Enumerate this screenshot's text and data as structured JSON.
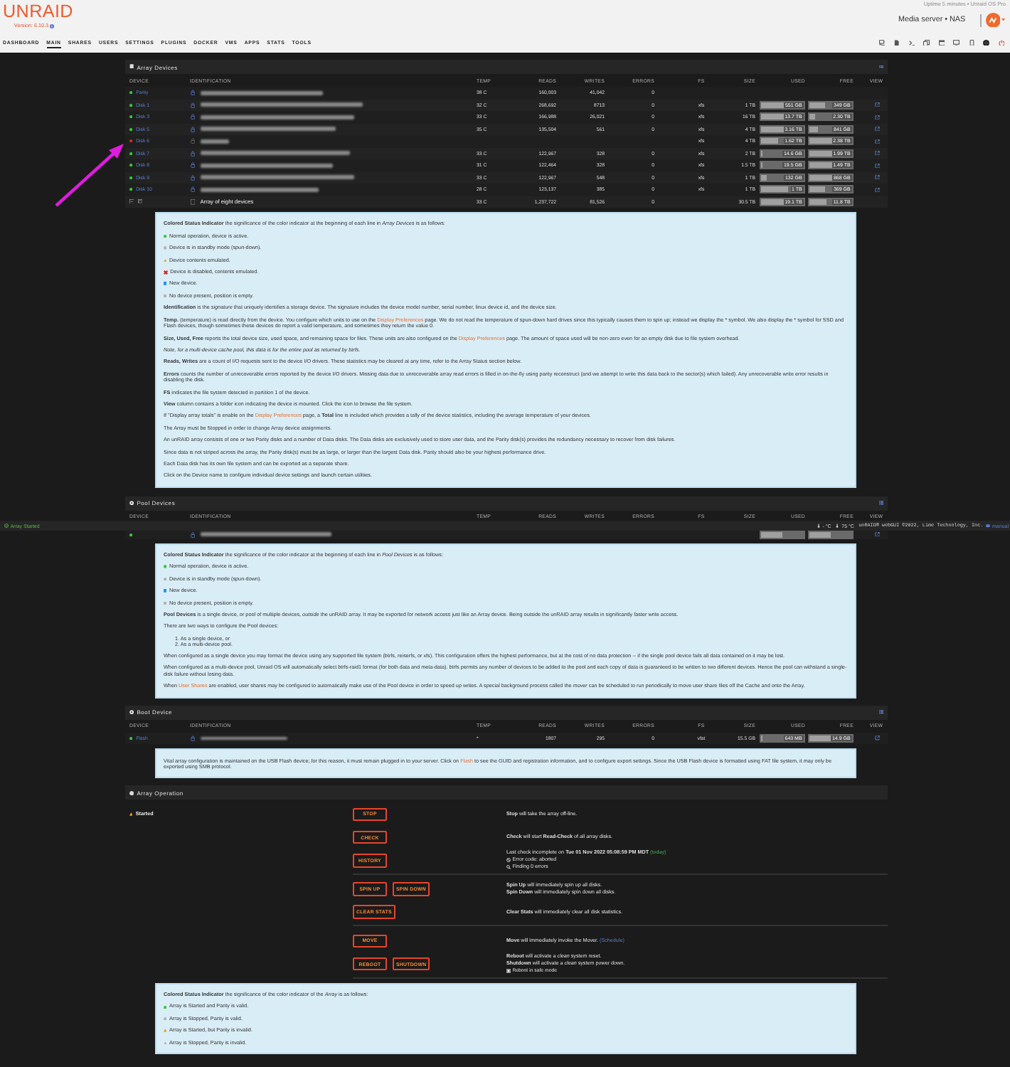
{
  "header": {
    "logo": "UNRAID",
    "version": "Version: 6.10.3",
    "uptime": "Uptime 5 minutes • Unraid OS Pro",
    "server": "Media server • NAS"
  },
  "nav": [
    {
      "label": "DASHBOARD",
      "selected": false
    },
    {
      "label": "MAIN",
      "selected": true
    },
    {
      "label": "SHARES",
      "selected": false
    },
    {
      "label": "USERS",
      "selected": false
    },
    {
      "label": "SETTINGS",
      "selected": false
    },
    {
      "label": "PLUGINS",
      "selected": false
    },
    {
      "label": "DOCKER",
      "selected": false
    },
    {
      "label": "VMS",
      "selected": false
    },
    {
      "label": "APPS",
      "selected": false
    },
    {
      "label": "STATS",
      "selected": false
    },
    {
      "label": "TOOLS",
      "selected": false
    }
  ],
  "toolbar": [
    {
      "kind": "chat"
    },
    {
      "kind": "doc"
    },
    {
      "kind": "terminal"
    },
    {
      "kind": "copy"
    },
    {
      "kind": "window"
    },
    {
      "kind": "monitor"
    },
    {
      "kind": "phone"
    },
    {
      "kind": "globe"
    },
    {
      "kind": "power"
    }
  ],
  "array_devices": {
    "title": "Array Devices",
    "columns": [
      "DEVICE",
      "IDENTIFICATION",
      "TEMP",
      "READS",
      "WRITES",
      "ERRORS",
      "FS",
      "SIZE",
      "USED",
      "FREE",
      "VIEW"
    ],
    "rows": [
      {
        "kind": "device",
        "color": "#33cc33",
        "name": "Parity",
        "mounted": true,
        "temp": "38 C",
        "reads": "160,003",
        "writes": "41,042",
        "errors": "0"
      },
      {
        "kind": "device",
        "color": "#33cc33",
        "name": "Disk 1",
        "mounted": true,
        "temp": "32 C",
        "reads": "268,692",
        "writes": "8713",
        "errors": "0",
        "fs": "xfs",
        "size": "1 TB",
        "used": {
          "text": "551 GB",
          "level": 0.55
        },
        "free": {
          "text": "349 GB",
          "level": 0.35
        },
        "view": true
      },
      {
        "kind": "device",
        "color": "#33cc33",
        "name": "Disk 3",
        "mounted": true,
        "temp": "33 C",
        "reads": "166,988",
        "writes": "26,021",
        "errors": "0",
        "fs": "xfs",
        "size": "16 TB",
        "used": {
          "text": "13.7 TB",
          "level": 0.86
        },
        "free": {
          "text": "2.30 TB",
          "level": 0.14
        },
        "view": true
      },
      {
        "kind": "device",
        "color": "#33cc33",
        "name": "Disk 5",
        "mounted": true,
        "temp": "35 C",
        "reads": "135,504",
        "writes": "561",
        "errors": "0",
        "fs": "xfs",
        "size": "4 TB",
        "used": {
          "text": "3.16 TB",
          "level": 0.79
        },
        "free": {
          "text": "841 GB",
          "level": 0.21
        },
        "view": true
      },
      {
        "kind": "device",
        "color": "#dd2222",
        "name": "Disk 6",
        "mounted": false,
        "fs": "xfs",
        "size": "4 TB",
        "used": {
          "text": "1.62 TB",
          "level": 0.41
        },
        "free": {
          "text": "2.38 TB",
          "level": 0.59
        },
        "view": true
      },
      {
        "kind": "device",
        "color": "#33cc33",
        "name": "Disk 7",
        "mounted": true,
        "temp": "33 C",
        "reads": "122,967",
        "writes": "328",
        "errors": "0",
        "fs": "xfs",
        "size": "2 TB",
        "used": {
          "text": "14.6 GB",
          "level": 0.01
        },
        "free": {
          "text": "1.99 TB",
          "level": 0.99
        },
        "view": true
      },
      {
        "kind": "device",
        "color": "#33cc33",
        "name": "Disk 8",
        "mounted": true,
        "temp": "31 C",
        "reads": "122,464",
        "writes": "328",
        "errors": "0",
        "fs": "xfs",
        "size": "1.5 TB",
        "used": {
          "text": "19.5 GB",
          "level": 0.01
        },
        "free": {
          "text": "1.49 TB",
          "level": 0.99
        },
        "view": true
      },
      {
        "kind": "device",
        "color": "#33cc33",
        "name": "Disk 9",
        "mounted": true,
        "temp": "33 C",
        "reads": "122,967",
        "writes": "548",
        "errors": "0",
        "fs": "xfs",
        "size": "1 TB",
        "used": {
          "text": "132 GB",
          "level": 0.13
        },
        "free": {
          "text": "868 GB",
          "level": 0.87
        },
        "view": true
      },
      {
        "kind": "device",
        "color": "#33cc33",
        "name": "Disk 10",
        "mounted": true,
        "temp": "28 C",
        "reads": "123,137",
        "writes": "385",
        "errors": "0",
        "fs": "xfs",
        "size": "1 TB",
        "used": {
          "text": "1 TB",
          "level": 0.63
        },
        "free": {
          "text": "369 GB",
          "level": 0.37
        },
        "view": true
      },
      {
        "kind": "total",
        "text": "Array of eight devices",
        "temp": "33 C",
        "reads": "1,237,722",
        "writes": "81,526",
        "errors": "0",
        "size": "30.5 TB",
        "used": {
          "text": "19.1 TB",
          "level": 0.63
        },
        "free": {
          "text": "11.8 TB",
          "level": 0.39
        }
      }
    ],
    "help": [
      {
        "kind": "text",
        "parts": [
          {
            "kind": "text",
            "text": "**Colored Status Indicator** the significance of the color indicator at the beginning of each line in *Array Devices* is as follows:"
          }
        ]
      },
      {
        "kind": "legend",
        "icon": {
          "kind": "circle",
          "color": "#33cc33"
        },
        "text": "Normal operation, device is active."
      },
      {
        "kind": "legend",
        "icon": {
          "kind": "circle",
          "color": "#b4b4b4"
        },
        "text": "Device is in standby mode (spun-down)."
      },
      {
        "kind": "legend",
        "icon": {
          "kind": "triangle",
          "color": "#f0a30a"
        },
        "text": "Device contents emulated."
      },
      {
        "kind": "legend",
        "icon": {
          "kind": "cross",
          "color": "#e22828"
        },
        "text": "Device is disabled, contents emulated."
      },
      {
        "kind": "legend",
        "icon": {
          "kind": "square",
          "color": "#1e90ff"
        },
        "text": "New device."
      },
      {
        "kind": "legend",
        "icon": {
          "kind": "square",
          "color": "#b4b4b4"
        },
        "text": "No device present, position is empty."
      },
      {
        "kind": "text",
        "parts": [
          {
            "kind": "text",
            "text": "**Identification** is the *signature* that uniquely identifies a storage device. The signature includes the device model number, serial number, linux device id, and the device size."
          }
        ]
      },
      {
        "kind": "text",
        "parts": [
          {
            "kind": "text",
            "text": "**Temp.** (temperature) is read directly from the device. You configure which units to use on the "
          },
          {
            "kind": "link",
            "text": "Display Preferences"
          },
          {
            "kind": "plain",
            "text": " page. We do not read the temperature of spun-down hard drives since this typically causes them to spin up; instead we display the * symbol. We also display the * symbol for SSD and Flash devices, though sometimes these devices do report a valid temperature, and sometimes they return the value 0."
          }
        ]
      },
      {
        "kind": "text",
        "parts": [
          {
            "kind": "text",
            "text": "**Size, Used, Free** reports the total device size, used space, and remaining space for files. These units are also configured on the "
          },
          {
            "kind": "link",
            "text": "Display Preferences"
          },
          {
            "kind": "text",
            "text": " page. The amount of space used will be non-zero even for an empty disk due to file system overhead."
          }
        ]
      },
      {
        "kind": "note",
        "parts": [
          {
            "kind": "text",
            "text": "Note, for a multi-device cache pool, this data is for the entire pool as returned by btrfs."
          }
        ]
      },
      {
        "kind": "text",
        "parts": [
          {
            "kind": "text",
            "text": "**Reads, Writes** are a count of I/O requests sent to the device I/O drivers. These statistics may be cleared at any time, refer to the Array Status section below."
          }
        ]
      },
      {
        "kind": "text",
        "parts": [
          {
            "kind": "text",
            "text": "**Errors** counts the number of unrecoverable errors reported by the device I/O drivers. Missing data due to unrecoverable array read errors is filled in on-the-fly using parity reconstruct (and we attempt to write this data back to the sector(s) which failed). Any unrecoverable write error results in disabling the disk."
          }
        ]
      },
      {
        "kind": "text",
        "parts": [
          {
            "kind": "text",
            "text": "**FS** indicates the file system detected in partition 1 of the device."
          }
        ]
      },
      {
        "kind": "text",
        "parts": [
          {
            "kind": "text",
            "text": "**View** column contains a folder icon indicating the device is mounted. Click the icon to browse the file system."
          }
        ]
      },
      {
        "kind": "text",
        "parts": [
          {
            "kind": "text",
            "text": "If \"Display array totals\" is enable on the "
          },
          {
            "kind": "link",
            "text": "Display Preferences"
          },
          {
            "kind": "text",
            "text": " page, a **Total** line is included which provides a tally of the device statistics, including the average temperature of your devices."
          }
        ]
      },
      {
        "kind": "text",
        "parts": [
          {
            "kind": "text",
            "text": "The Array must be Stopped in order to change Array device assignments."
          }
        ]
      },
      {
        "kind": "text",
        "parts": [
          {
            "kind": "text",
            "text": "An unRAID array consists of one or two Parity disks and a number of Data disks. The Data disks are exclusively used to store user data, and the Parity disk(s) provides the redundancy necessary to recover from disk failures."
          }
        ]
      },
      {
        "kind": "text",
        "parts": [
          {
            "kind": "text",
            "text": "Since data is not striped across the array, the Parity disk(s) must be as large, or larger than the largest Data disk. Parity should also be your highest performance drive."
          }
        ]
      },
      {
        "kind": "text",
        "parts": [
          {
            "kind": "text",
            "text": "Each Data disk has its own file system and can be exported as a separate share."
          }
        ]
      },
      {
        "kind": "text",
        "parts": [
          {
            "kind": "text",
            "text": "Click on the Device name to configure individual device settings and launch certain utilities."
          }
        ]
      }
    ]
  },
  "pool_devices": {
    "title": "Pool Devices",
    "columns": [
      "DEVICE",
      "IDENTIFICATION",
      "TEMP",
      "READS",
      "WRITES",
      "ERRORS",
      "FS",
      "SIZE",
      "USED",
      "FREE",
      "VIEW"
    ],
    "rows": [
      {
        "kind": "device",
        "color": "#33cc33",
        "mounted": true,
        "used": {
          "level": 0.5
        },
        "free": {
          "level": 0.5
        },
        "view": true
      }
    ],
    "help": [
      {
        "kind": "text",
        "parts": [
          {
            "kind": "text",
            "text": "**Colored Status Indicator** the significance of the color indicator at the beginning of each line in *Pool Devices* is as follows:"
          }
        ]
      },
      {
        "kind": "legend",
        "icon": {
          "kind": "circle",
          "color": "#33cc33"
        },
        "text": "Normal operation, device is active."
      },
      {
        "kind": "legend",
        "icon": {
          "kind": "circle",
          "color": "#b4b4b4"
        },
        "text": "Device is in standby mode (spun-down)."
      },
      {
        "kind": "legend",
        "icon": {
          "kind": "square",
          "color": "#1e90ff"
        },
        "text": "New device."
      },
      {
        "kind": "legend",
        "icon": {
          "kind": "square",
          "color": "#b4b4b4"
        },
        "text": "No device present, position is empty."
      },
      {
        "kind": "text",
        "parts": [
          {
            "kind": "text",
            "text": "**Pool Devices** is a single device, or pool of multiple devices, *outside* the unRAID array. It may be exported for network access just like an Array device. Being outside the unRAID array results in significantly faster write access."
          }
        ]
      },
      {
        "kind": "text",
        "parts": [
          {
            "kind": "text",
            "text": "There are two ways to configure the Pool devices:"
          }
        ]
      },
      {
        "kind": "list",
        "items": [
          "1. As a single device, or",
          "2. As a multi-device pool."
        ]
      },
      {
        "kind": "text",
        "parts": [
          {
            "kind": "text",
            "text": "When configured as a single device you may format the device using any supported file system (btrfs, reiserfs, or xfs). This configuration offers the highest performance, but at the cost of no data protection -- if the single pool device fails all data contained on it may be lost."
          }
        ]
      },
      {
        "kind": "text",
        "parts": [
          {
            "kind": "text",
            "text": "When configured as a multi-device pool, Unraid OS will automatically select btrfs-raid1 format (for both data and meta-data). btrfs permits any number of devices to be added to the pool and each copy of data is guaranteed to be written to two different devices. Hence the pool can withstand a single-disk failure without losing data."
          }
        ]
      },
      {
        "kind": "text",
        "parts": [
          {
            "kind": "text",
            "text": "When "
          },
          {
            "kind": "link",
            "text": "User Shares"
          },
          {
            "kind": "text",
            "text": " are enabled, user shares may be configured to automatically make use of the Pool device in order to speed up writes. A special background process called the *mover* can be scheduled to run periodically to move user share files off the Cache and onto the Array."
          }
        ]
      }
    ]
  },
  "boot_device": {
    "title": "Boot Device",
    "columns": [
      "DEVICE",
      "IDENTIFICATION",
      "TEMP",
      "READS",
      "WRITES",
      "ERRORS",
      "FS",
      "SIZE",
      "USED",
      "FREE",
      "VIEW"
    ],
    "rows": [
      {
        "kind": "device",
        "color": "#33cc33",
        "name": "Flash",
        "mounted": true,
        "temp": "*",
        "reads": "1807",
        "writes": "295",
        "errors": "0",
        "fs": "vfat",
        "size": "15.5 GB",
        "used": {
          "text": "643 MB",
          "level": 0.04
        },
        "free": {
          "text": "14.9 GB",
          "level": 0.96
        },
        "view": true
      }
    ],
    "help": [
      {
        "kind": "text",
        "parts": [
          {
            "kind": "text",
            "text": "Vital array configuration is maintained on the USB Flash device; for this reason, it must remain plugged in to your server. Click on "
          },
          {
            "kind": "link",
            "text": "Flash"
          },
          {
            "kind": "text",
            "text": " to see the GUID and registration information, and to configure export settings. Since the USB Flash device is formatted using FAT file system, it may only be exported using SMB protocol."
          }
        ]
      }
    ]
  },
  "array_operation": {
    "title": "Array Operation",
    "state": {
      "kind": "warning",
      "text": "Started"
    },
    "groups": [
      {
        "rows": [
          {
            "buttons": [
              "STOP"
            ],
            "lines": [
              {
                "kind": "text",
                "parts": [
                  {
                    "kind": "text",
                    "text": "**Stop** will take the array off-line."
                  }
                ]
              }
            ]
          },
          {
            "buttons": [
              "CHECK"
            ],
            "lines": [
              {
                "kind": "text",
                "parts": [
                  {
                    "kind": "text",
                    "text": "**Check** will start **Read-Check** of all array disks."
                  }
                ]
              }
            ]
          },
          {
            "buttons": [
              "HISTORY"
            ],
            "lines": [
              {
                "kind": "text",
                "parts": [
                  {
                    "kind": "text",
                    "text": "Last check incomplete on **Tue 01 Nov 2022 05:08:59 PM MDT** "
                  },
                  {
                    "kind": "ok",
                    "text": "(today)"
                  }
                ]
              },
              {
                "kind": "error",
                "text": "Error code: aborted"
              },
              {
                "kind": "finding",
                "text": "Finding 0 errors"
              }
            ]
          }
        ]
      },
      {
        "rows": [
          {
            "buttons": [
              "SPIN UP",
              "SPIN DOWN"
            ],
            "lines": [
              {
                "kind": "text",
                "parts": [
                  {
                    "kind": "text",
                    "text": "**Spin Up** will immediately spin up all disks."
                  }
                ]
              },
              {
                "kind": "text",
                "parts": [
                  {
                    "kind": "text",
                    "text": "**Spin Down** will immediately spin down all disks."
                  }
                ]
              }
            ]
          },
          {
            "buttons": [
              "CLEAR STATS"
            ],
            "lines": [
              {
                "kind": "text",
                "parts": [
                  {
                    "kind": "text",
                    "text": "**Clear Stats** will immediately clear all disk statistics."
                  }
                ]
              }
            ]
          }
        ]
      },
      {
        "rows": [
          {
            "buttons": [
              "MOVE"
            ],
            "lines": [
              {
                "kind": "text",
                "parts": [
                  {
                    "kind": "text",
                    "text": "**Move** will immediately invoke the Mover. "
                  },
                  {
                    "kind": "link",
                    "text": "(Schedule)"
                  }
                ]
              }
            ]
          },
          {
            "buttons": [
              "REBOOT",
              "SHUTDOWN"
            ],
            "lines": [
              {
                "kind": "text",
                "parts": [
                  {
                    "kind": "text",
                    "text": "**Reboot** will activate a *clean* system reset."
                  }
                ]
              },
              {
                "kind": "text",
                "parts": [
                  {
                    "kind": "text",
                    "text": "**Shutdown** will activate a *clean* system power down."
                  }
                ]
              },
              {
                "kind": "checkbox",
                "checked": false,
                "text": "Reboot in safe mode"
              }
            ]
          }
        ]
      }
    ],
    "help": [
      {
        "kind": "text",
        "parts": [
          {
            "kind": "text",
            "text": "**Colored Status Indicator** the significance of the color indicator of the *Array* is as follows:"
          }
        ]
      },
      {
        "kind": "legend",
        "icon": {
          "kind": "circle",
          "color": "#33cc33"
        },
        "text": "Array is Started and Parity is valid."
      },
      {
        "kind": "legend",
        "icon": {
          "kind": "circle",
          "color": "#b4b4b4"
        },
        "text": "Array is Stopped, Parity is valid."
      },
      {
        "kind": "legend",
        "icon": {
          "kind": "triangle",
          "color": "#f0a30a"
        },
        "text": "Array is Started, but Parity is invalid."
      },
      {
        "kind": "legend",
        "icon": {
          "kind": "triangle",
          "color": "#b4b4b4"
        },
        "text": "Array is Stopped, Parity is invalid."
      }
    ]
  },
  "annotations": [
    {
      "kind": "arrow"
    }
  ],
  "status_bar": {
    "array_state": "Array Started",
    "temps": [
      "- °C",
      "75 °C"
    ],
    "copyright": "unRAID® webGUI ©2022, Lime Technology, Inc.",
    "manual": "manual"
  }
}
